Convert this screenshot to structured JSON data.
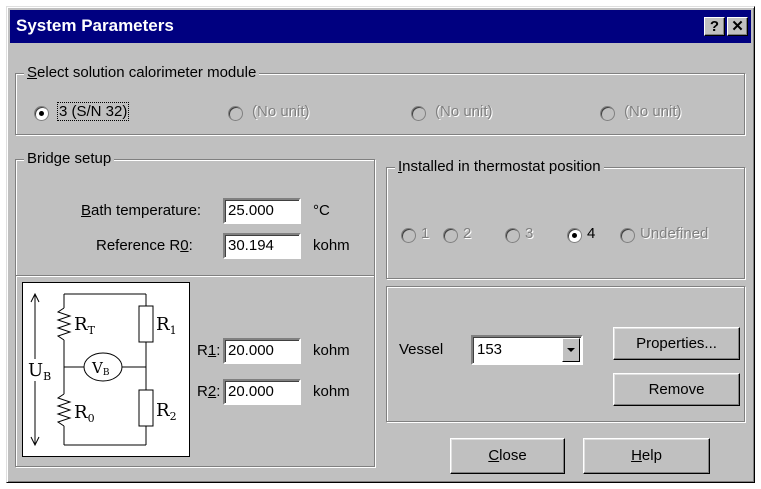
{
  "window": {
    "title": "System Parameters",
    "help_glyph": "?",
    "close_glyph": "✕"
  },
  "module_group": {
    "legend_key": "S",
    "legend_rest": "elect solution calorimeter module",
    "options": [
      {
        "label": "3 (S/N 32)",
        "selected": true,
        "enabled": true
      },
      {
        "label": "(No unit)",
        "selected": false,
        "enabled": false
      },
      {
        "label": "(No unit)",
        "selected": false,
        "enabled": false
      },
      {
        "label": "(No unit)",
        "selected": false,
        "enabled": false
      }
    ]
  },
  "bridge": {
    "legend": "Bridge setup",
    "bath_key": "B",
    "bath_rest": "ath temperature:",
    "bath_value": "25.000",
    "bath_unit": "°C",
    "ref_pre": "Reference R",
    "ref_key": "0",
    "ref_post": ":",
    "ref_value": "30.194",
    "ref_unit": "kohm",
    "r1_pre": "R",
    "r1_key": "1",
    "r1_post": ":",
    "r1_value": "20.000",
    "r1_unit": "kohm",
    "r2_pre": "R",
    "r2_key": "2",
    "r2_post": ":",
    "r2_value": "20.000",
    "r2_unit": "kohm",
    "diagram": {
      "ub": "U",
      "ub_sub": "B",
      "rt": "R",
      "rt_sub": "T",
      "r0": "R",
      "r0_sub": "0",
      "r1": "R",
      "r1_sub": "1",
      "r2": "R",
      "r2_sub": "2",
      "vb": "V",
      "vb_sub": "B"
    }
  },
  "thermostat": {
    "legend_key": "I",
    "legend_rest": "nstalled in thermostat position",
    "options": [
      {
        "label": "1",
        "selected": false,
        "enabled": false
      },
      {
        "label": "2",
        "selected": false,
        "enabled": false
      },
      {
        "label": "3",
        "selected": false,
        "enabled": false
      },
      {
        "label": "4",
        "selected": true,
        "enabled": true
      },
      {
        "label": "Undefined",
        "selected": false,
        "enabled": false
      }
    ]
  },
  "vessel": {
    "label": "Vessel",
    "value": "153",
    "properties_button": "Properties...",
    "remove_button": "Remove"
  },
  "footer": {
    "close_key": "C",
    "close_rest": "lose",
    "help_key": "H",
    "help_rest": "elp"
  }
}
